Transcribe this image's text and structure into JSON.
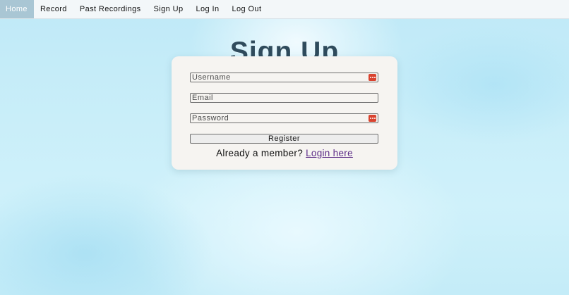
{
  "nav": {
    "items": [
      {
        "label": "Home",
        "active": true
      },
      {
        "label": "Record",
        "active": false
      },
      {
        "label": "Past Recordings",
        "active": false
      },
      {
        "label": "Sign Up",
        "active": false
      },
      {
        "label": "Log In",
        "active": false
      },
      {
        "label": "Log Out",
        "active": false
      }
    ]
  },
  "page": {
    "title": "Sign Up"
  },
  "form": {
    "username": {
      "placeholder": "Username",
      "value": ""
    },
    "email": {
      "placeholder": "Email",
      "value": ""
    },
    "password": {
      "placeholder": "Password",
      "value": ""
    },
    "register_label": "Register",
    "member_text": "Already a member?",
    "login_link_label": "Login here"
  },
  "icons": {
    "password_manager_icon": "password-key-icon"
  },
  "colors": {
    "title": "#2f4b5c",
    "nav_active_bg": "#a9c6d4",
    "key_icon": "#d9432f",
    "link": "#5b2a86",
    "card_bg": "#f6f4f1"
  }
}
